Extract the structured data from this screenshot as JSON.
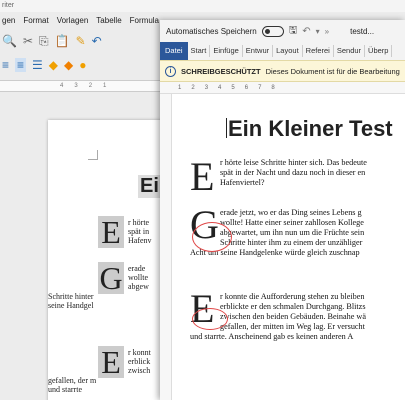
{
  "bg": {
    "title": "riter",
    "menu": [
      "gen",
      "Format",
      "Vorlagen",
      "Tabelle",
      "Formula"
    ],
    "ruler_ticks": [
      "4",
      "3",
      "2",
      "1"
    ],
    "heading": "Ei",
    "p1": [
      "r hörte",
      "spät in",
      "Hafenv"
    ],
    "p2": [
      "erade",
      "wollte",
      "abgew"
    ],
    "p2_tail": [
      "Schritte hinter",
      "seine Handgel"
    ],
    "p3": [
      "r konnt",
      "erblick",
      "zwisch"
    ],
    "p3_tail": [
      "gefallen, der m",
      "und starrte"
    ]
  },
  "word": {
    "autosave_label": "Automatisches Speichern",
    "doc_title": "testd...",
    "tabs": [
      "Datei",
      "Start",
      "Einfüge",
      "Entwur",
      "Layout",
      "Referei",
      "Sendur",
      "Überp"
    ],
    "banner_label": "SCHREIBGESCHÜTZT",
    "banner_text": "Dieses Dokument ist für die Bearbeitung",
    "ruler_ticks": [
      "1",
      "2",
      "3",
      "4",
      "5",
      "6",
      "7",
      "8"
    ],
    "heading": "Ein Kleiner Test",
    "p1": {
      "cap": "E",
      "lines": [
        "r hörte leise Schritte hinter sich. Das bedeute",
        "spät in der Nacht und dazu noch in dieser en",
        "Hafenviertel?"
      ]
    },
    "p2": {
      "cap": "G",
      "lines": [
        "erade jetzt, wo er das Ding seines Lebens g",
        "wollte! Hatte einer seiner zahllosen Kollege",
        "abgewartet, um ihn nun um die Früchte sein",
        "Schritte hinter ihm zu einem der unzähliger",
        "Acht um seine Handgelenke würde gleich zuschnap"
      ]
    },
    "p3": {
      "cap": "E",
      "lines": [
        "r konnte die Aufforderung stehen zu bleiben",
        "erblickte er den schmalen Durchgang. Blitzs",
        "zwischen den beiden Gebäuden. Beinahe wä",
        "gefallen, der mitten im Weg lag. Er versucht",
        "und starrte. Anscheinend gab es keinen anderen A"
      ]
    }
  }
}
